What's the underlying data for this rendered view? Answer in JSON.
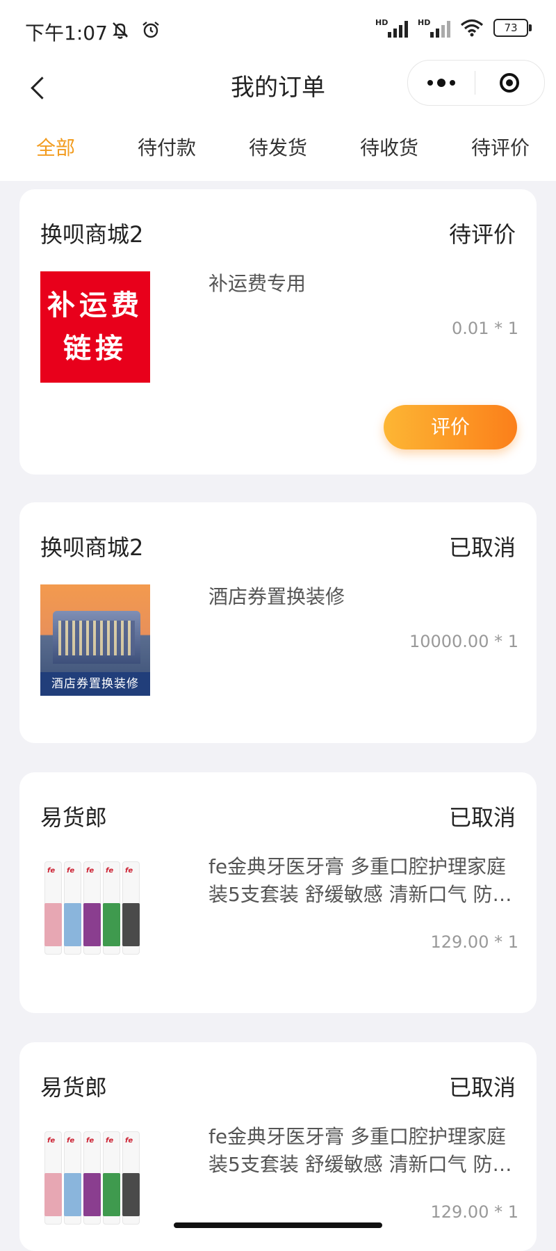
{
  "status_bar": {
    "time": "下午1:07",
    "hd1": "HD",
    "hd2": "HD",
    "battery": "73"
  },
  "nav": {
    "title": "我的订单"
  },
  "tabs": [
    {
      "label": "全部",
      "active": true
    },
    {
      "label": "待付款",
      "active": false
    },
    {
      "label": "待发货",
      "active": false
    },
    {
      "label": "待收货",
      "active": false
    },
    {
      "label": "待评价",
      "active": false
    }
  ],
  "orders": [
    {
      "shop": "换呗商城2",
      "status": "待评价",
      "thumb_text": [
        "补运费",
        "链接"
      ],
      "name": "补运费专用",
      "price": "0.01 * 1",
      "action": "评价"
    },
    {
      "shop": "换呗商城2",
      "status": "已取消",
      "thumb_text": "酒店券置换装修",
      "name": "酒店券置换装修",
      "price": "10000.00 * 1"
    },
    {
      "shop": "易货郎",
      "status": "已取消",
      "name": "fe金典牙医牙膏 多重口腔护理家庭装5支套装 舒缓敏感 清新口气 防蛀固齿",
      "price": "129.00 * 1"
    },
    {
      "shop": "易货郎",
      "status": "已取消",
      "name": "fe金典牙医牙膏 多重口腔护理家庭装5支套装 舒缓敏感 清新口气 防蛀固齿",
      "price": "129.00 * 1"
    }
  ],
  "colors": {
    "accent": "#f29c1f",
    "button_start": "#fdb634",
    "button_end": "#fb7f1a",
    "page_bg": "#f2f2f6"
  }
}
